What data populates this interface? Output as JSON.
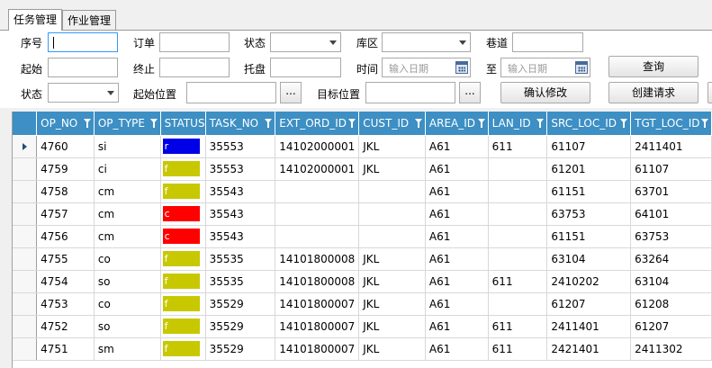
{
  "tabs": [
    {
      "label": "任务管理",
      "active": true
    },
    {
      "label": "作业管理",
      "active": false
    }
  ],
  "filters": {
    "seq_label": "序号",
    "order_label": "订单",
    "status_label": "状态",
    "area_label": "库区",
    "lane_label": "巷道",
    "start_label": "起始",
    "end_label": "终止",
    "pallet_label": "托盘",
    "time_label": "时间",
    "to_label": "至",
    "date_placeholder": "输入日期",
    "status2_label": "状态",
    "src_pos_label": "起始位置",
    "tgt_pos_label": "目标位置",
    "browse_label": "..."
  },
  "buttons": {
    "query": "查询",
    "confirm_modify": "确认修改",
    "create_request": "创建请求"
  },
  "colors": {
    "header_bg": "#3d8fc4",
    "status_f": "#c8c800",
    "status_c": "#ff0000",
    "status_r": "#0000e6"
  },
  "table": {
    "columns": [
      "OP_NO",
      "OP_TYPE",
      "STATUS",
      "TASK_NO",
      "EXT_ORD_ID",
      "CUST_ID",
      "AREA_ID",
      "LAN_ID",
      "SRC_LOC_ID",
      "TGT_LOC_ID"
    ],
    "rows": [
      {
        "op_no": "4760",
        "op_type": "si",
        "status": "r",
        "status_color": "#0000e6",
        "task_no": "35553",
        "ext_ord_id": "14102000001",
        "cust_id": "JKL",
        "area_id": "A61",
        "lan_id": "611",
        "src_loc_id": "61107",
        "tgt_loc_id": "2411401"
      },
      {
        "op_no": "4759",
        "op_type": "ci",
        "status": "f",
        "status_color": "#c8c800",
        "task_no": "35553",
        "ext_ord_id": "14102000001",
        "cust_id": "JKL",
        "area_id": "A61",
        "lan_id": "",
        "src_loc_id": "61201",
        "tgt_loc_id": "61107"
      },
      {
        "op_no": "4758",
        "op_type": "cm",
        "status": "f",
        "status_color": "#c8c800",
        "task_no": "35543",
        "ext_ord_id": "",
        "cust_id": "",
        "area_id": "A61",
        "lan_id": "",
        "src_loc_id": "61151",
        "tgt_loc_id": "63701"
      },
      {
        "op_no": "4757",
        "op_type": "cm",
        "status": "c",
        "status_color": "#ff0000",
        "task_no": "35543",
        "ext_ord_id": "",
        "cust_id": "",
        "area_id": "A61",
        "lan_id": "",
        "src_loc_id": "63753",
        "tgt_loc_id": "64101"
      },
      {
        "op_no": "4756",
        "op_type": "cm",
        "status": "c",
        "status_color": "#ff0000",
        "task_no": "35543",
        "ext_ord_id": "",
        "cust_id": "",
        "area_id": "A61",
        "lan_id": "",
        "src_loc_id": "61151",
        "tgt_loc_id": "63753"
      },
      {
        "op_no": "4755",
        "op_type": "co",
        "status": "f",
        "status_color": "#c8c800",
        "task_no": "35535",
        "ext_ord_id": "14101800008",
        "cust_id": "JKL",
        "area_id": "A61",
        "lan_id": "",
        "src_loc_id": "63104",
        "tgt_loc_id": "63264"
      },
      {
        "op_no": "4754",
        "op_type": "so",
        "status": "f",
        "status_color": "#c8c800",
        "task_no": "35535",
        "ext_ord_id": "14101800008",
        "cust_id": "JKL",
        "area_id": "A61",
        "lan_id": "611",
        "src_loc_id": "2410202",
        "tgt_loc_id": "63104"
      },
      {
        "op_no": "4753",
        "op_type": "co",
        "status": "f",
        "status_color": "#c8c800",
        "task_no": "35529",
        "ext_ord_id": "14101800007",
        "cust_id": "JKL",
        "area_id": "A61",
        "lan_id": "",
        "src_loc_id": "61207",
        "tgt_loc_id": "61208"
      },
      {
        "op_no": "4752",
        "op_type": "so",
        "status": "f",
        "status_color": "#c8c800",
        "task_no": "35529",
        "ext_ord_id": "14101800007",
        "cust_id": "JKL",
        "area_id": "A61",
        "lan_id": "611",
        "src_loc_id": "2411401",
        "tgt_loc_id": "61207"
      },
      {
        "op_no": "4751",
        "op_type": "sm",
        "status": "f",
        "status_color": "#c8c800",
        "task_no": "35529",
        "ext_ord_id": "14101800007",
        "cust_id": "JKL",
        "area_id": "A61",
        "lan_id": "611",
        "src_loc_id": "2421401",
        "tgt_loc_id": "2411302"
      }
    ]
  }
}
